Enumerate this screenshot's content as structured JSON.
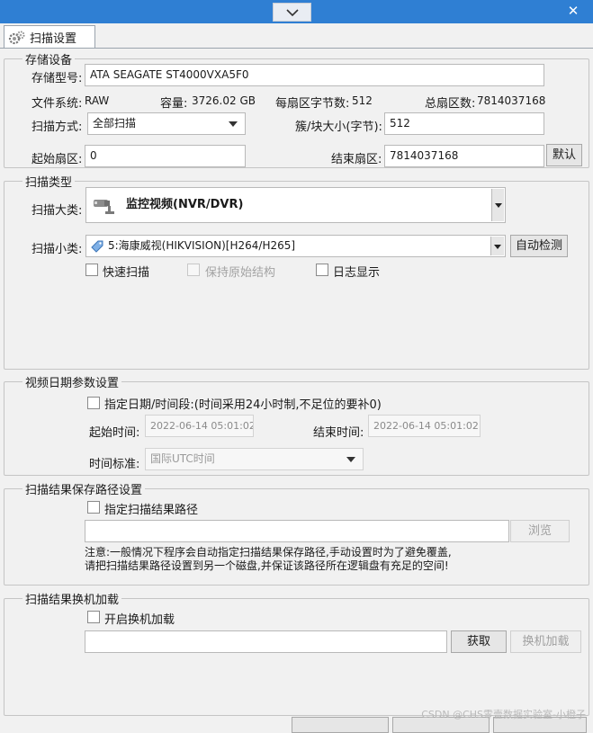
{
  "window": {
    "close_glyph": "✕"
  },
  "tab": {
    "label": "扫描设置",
    "icon": "gear-icon"
  },
  "storage": {
    "legend": "存储设备",
    "model_label": "存储型号:",
    "model_value": "ATA     SEAGATE ST4000VXA5F0",
    "fs_label": "文件系统:",
    "fs_value": "RAW",
    "capacity_label": "容量:",
    "capacity_value": "3726.02 GB",
    "bytes_per_sector_label": "每扇区字节数:",
    "bytes_per_sector_value": "512",
    "total_sectors_label": "总扇区数:",
    "total_sectors_value": "7814037168",
    "scan_mode_label": "扫描方式:",
    "scan_mode_value": "全部扫描",
    "cluster_size_label": "簇/块大小(字节):",
    "cluster_size_value": "512",
    "start_sector_label": "起始扇区:",
    "start_sector_value": "0",
    "end_sector_label": "结束扇区:",
    "end_sector_value": "7814037168",
    "default_button": "默认"
  },
  "scan_type": {
    "legend": "扫描类型",
    "major_label": "扫描大类:",
    "major_value": "监控视频(NVR/DVR)",
    "major_icon": "camera-icon",
    "minor_label": "扫描小类:",
    "minor_value": "5:海康威视(HIKVISION)[H264/H265]",
    "minor_icon": "tag-icon",
    "auto_detect_button": "自动检测",
    "quick_scan_label": "快速扫描",
    "keep_structure_label": "保持原始结构",
    "log_display_label": "日志显示"
  },
  "video_date": {
    "legend": "视频日期参数设置",
    "specify_label": "指定日期/时间段:(时间采用24小时制,不足位的要补0)",
    "start_label": "起始时间:",
    "start_value": "2022-06-14 05:01:02",
    "end_label": "结束时间:",
    "end_value": "2022-06-14 05:01:02",
    "standard_label": "时间标准:",
    "standard_value": "国际UTC时间"
  },
  "result_path": {
    "legend": "扫描结果保存路径设置",
    "specify_label": "指定扫描结果路径",
    "path_value": "",
    "browse_button": "浏览",
    "note_line1": "注意:一般情况下程序会自动指定扫描结果保存路径,手动设置时为了避免覆盖,",
    "note_line2": "请把扫描结果路径设置到另一个磁盘,并保证该路径所在逻辑盘有充足的空间!"
  },
  "switch_load": {
    "legend": "扫描结果换机加载",
    "enable_label": "开启换机加载",
    "path_value": "",
    "fetch_button": "获取",
    "load_button": "换机加载"
  },
  "watermark": "CSDN @CHS零壹数据实验室-小橙子"
}
